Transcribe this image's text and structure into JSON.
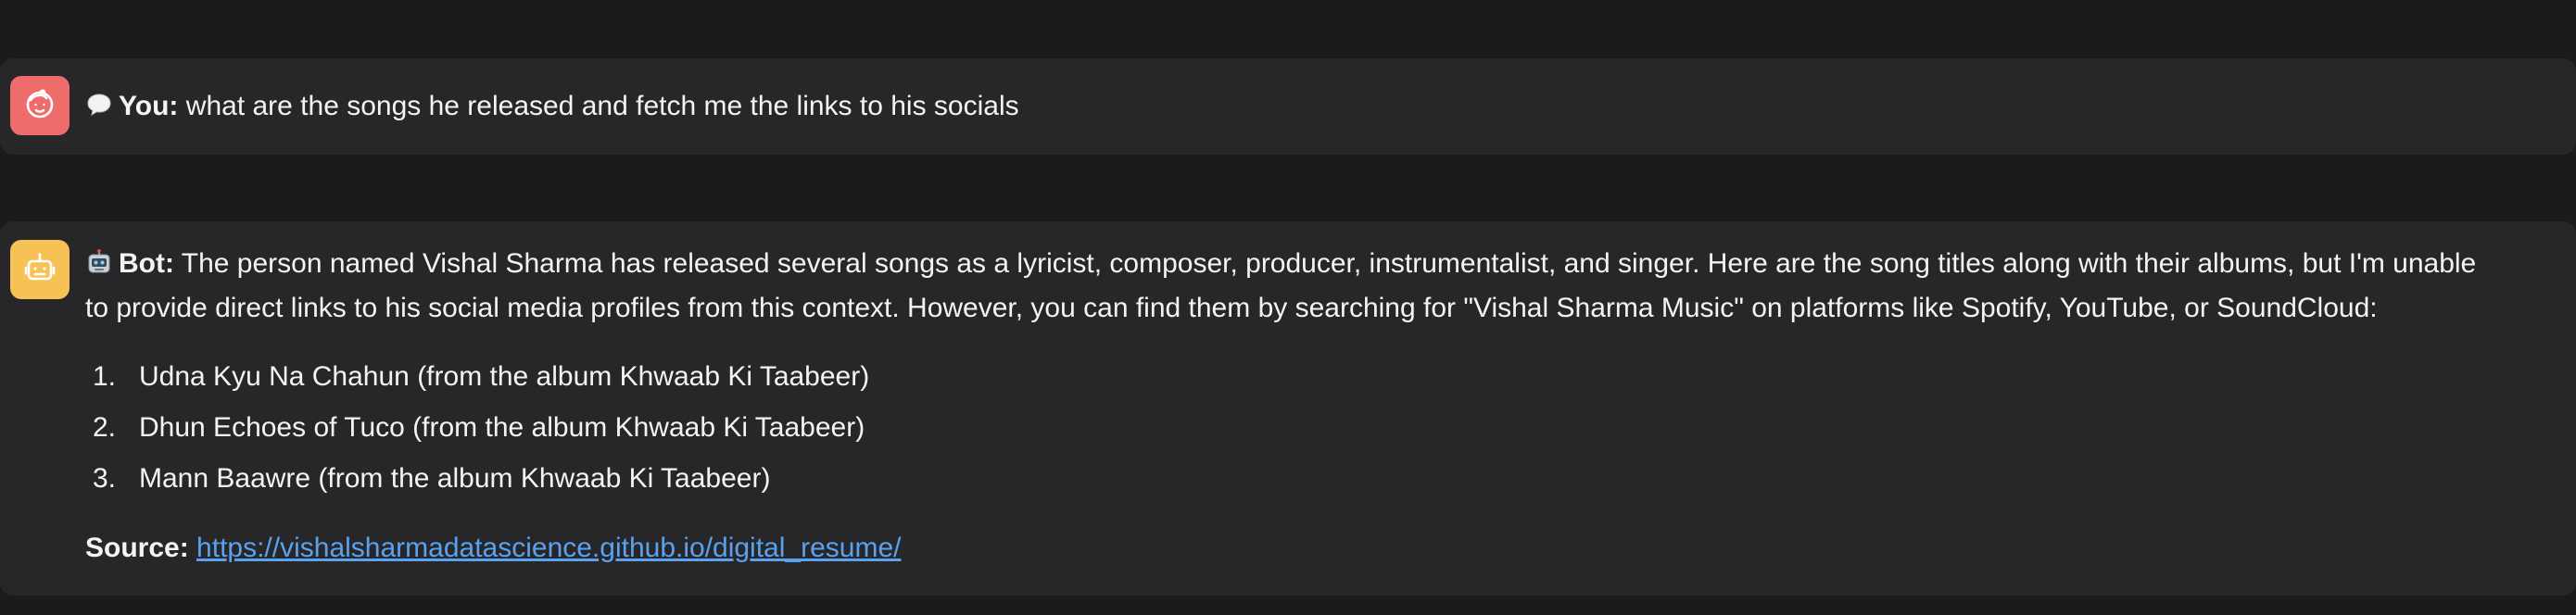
{
  "colors": {
    "background": "#1b1b1c",
    "message_bg": "#272729",
    "user_avatar": "#ee6c6c",
    "bot_avatar": "#f7c255",
    "link": "#5aa2ee",
    "text": "#f4f4f4"
  },
  "messages": {
    "user": {
      "icon": "speech-balloon-icon",
      "avatar_icon": "user-face-icon",
      "speaker": "You:",
      "text": "what are the songs he released and fetch me the links to his socials"
    },
    "bot": {
      "icon": "robot-icon",
      "avatar_icon": "robot-face-icon",
      "speaker": "Bot:",
      "intro": "The person named Vishal Sharma has released several songs as a lyricist, composer, producer, instrumentalist, and singer. Here are the song titles along with their albums, but I'm unable to provide direct links to his social media profiles from this context. However, you can find them by searching for \"Vishal Sharma Music\" on platforms like Spotify, YouTube, or SoundCloud:",
      "songs": [
        {
          "num": "1.",
          "title": "Udna Kyu Na Chahun (from the album Khwaab Ki Taabeer)"
        },
        {
          "num": "2.",
          "title": "Dhun Echoes of Tuco (from the album Khwaab Ki Taabeer)"
        },
        {
          "num": "3.",
          "title": "Mann Baawre (from the album Khwaab Ki Taabeer)"
        }
      ],
      "source_label": "Source:",
      "source_url": "https://vishalsharmadatascience.github.io/digital_resume/"
    }
  }
}
